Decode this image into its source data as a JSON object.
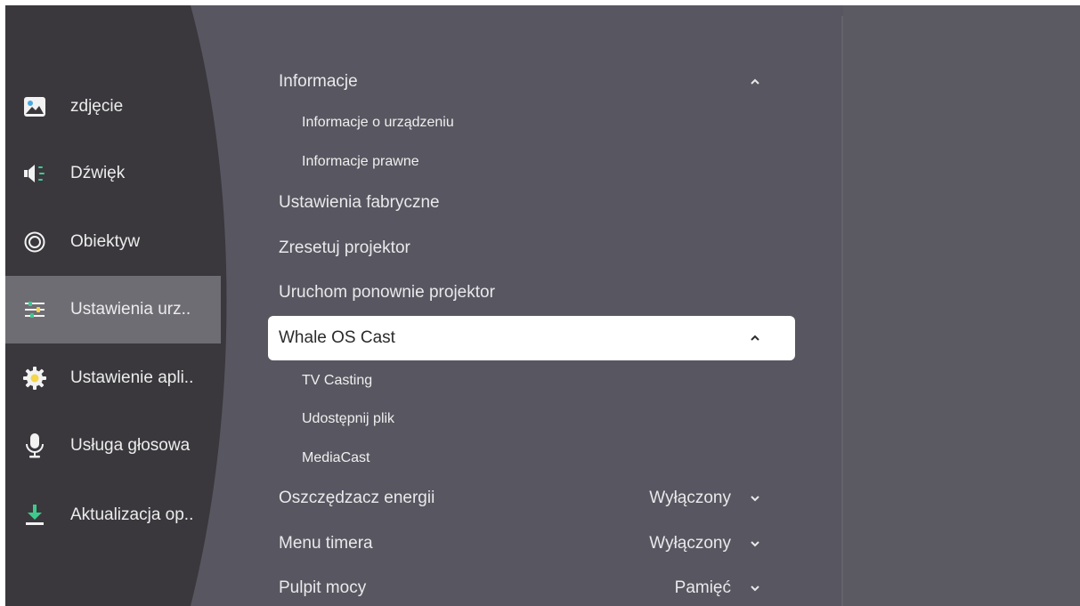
{
  "sidebar": {
    "items": [
      {
        "label": "zdjęcie",
        "icon": "picture-icon"
      },
      {
        "label": "Dźwięk",
        "icon": "speaker-icon"
      },
      {
        "label": "Obiektyw",
        "icon": "lens-icon"
      },
      {
        "label": "Ustawienia urz..",
        "icon": "settings-sliders-icon",
        "active": true
      },
      {
        "label": "Ustawienie apli..",
        "icon": "gear-icon"
      },
      {
        "label": "Usługa głosowa",
        "icon": "microphone-icon"
      },
      {
        "label": "Aktualizacja op..",
        "icon": "download-icon"
      }
    ]
  },
  "menu": {
    "informacje": {
      "label": "Informacje",
      "expanded": true
    },
    "informacje_o_urzadzeniu": {
      "label": "Informacje o urządzeniu"
    },
    "informacje_prawne": {
      "label": "Informacje prawne"
    },
    "ustawienia_fabryczne": {
      "label": "Ustawienia fabryczne"
    },
    "zresetuj": {
      "label": "Zresetuj projektor"
    },
    "uruchom": {
      "label": "Uruchom ponownie projektor"
    },
    "whale_cast": {
      "label": "Whale OS Cast",
      "expanded": true,
      "selected": true
    },
    "tv_casting": {
      "label": "TV Casting"
    },
    "udostepnij": {
      "label": "Udostępnij plik"
    },
    "mediacast": {
      "label": "MediaCast"
    },
    "oszczedzacz": {
      "label": "Oszczędzacz energii",
      "value": "Wyłączony"
    },
    "menu_timera": {
      "label": "Menu timera",
      "value": "Wyłączony"
    },
    "pulpit": {
      "label": "Pulpit mocy",
      "value": "Pamięć"
    }
  },
  "colors": {
    "background": "#585660",
    "sidebar": "#3a383d",
    "active_item": "#6f6d74",
    "accent_green": "#3fc98f",
    "accent_yellow": "#f4d64a"
  }
}
